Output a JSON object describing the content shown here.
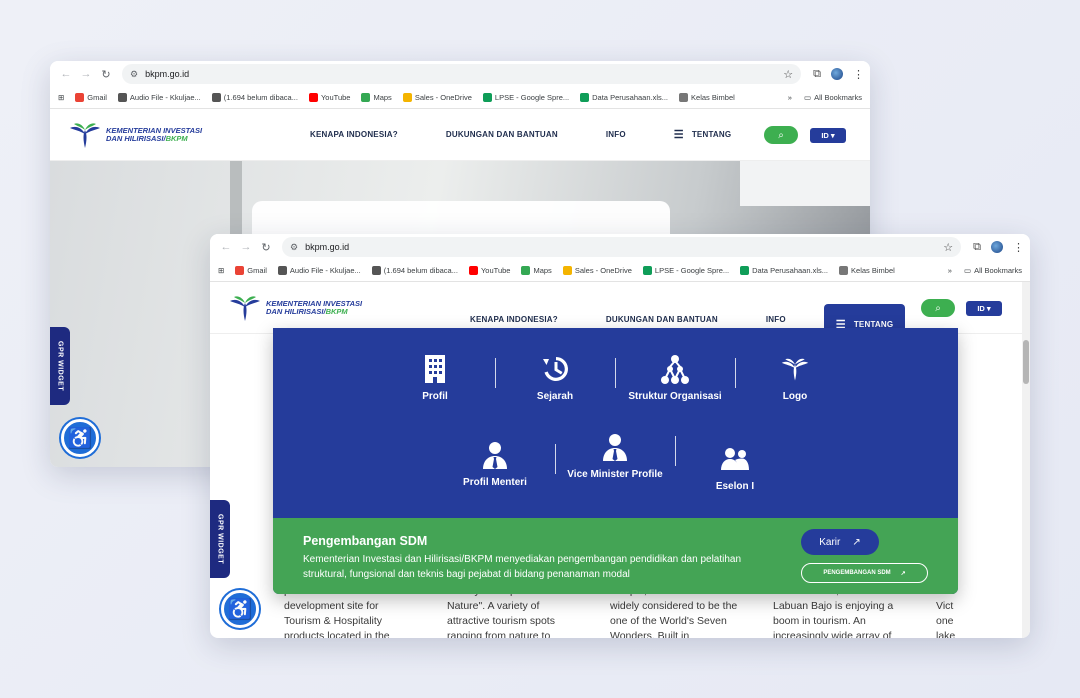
{
  "browser": {
    "url": "bkpm.go.id",
    "bookmarks": [
      {
        "label": "Gmail",
        "color": "#ea4335"
      },
      {
        "label": "Audio File - Kkuljae...",
        "color": "#555555"
      },
      {
        "label": "(1.694 belum dibaca...",
        "color": "#555555"
      },
      {
        "label": "YouTube",
        "color": "#ff0000"
      },
      {
        "label": "Maps",
        "color": "#34a853"
      },
      {
        "label": "Sales - OneDrive",
        "color": "#f4b400"
      },
      {
        "label": "LPSE - Google Spre...",
        "color": "#0f9d58"
      },
      {
        "label": "Data Perusahaan.xls...",
        "color": "#0f9d58"
      },
      {
        "label": "Kelas Bimbel",
        "color": "#777777"
      }
    ],
    "more": "»",
    "all_bookmarks": "All Bookmarks"
  },
  "site": {
    "logo_line1": "KEMENTERIAN INVESTASI",
    "logo_line2a": "DAN HILIRISASI/",
    "logo_line2b": "BKPM",
    "nav": [
      "KENAPA INDONESIA?",
      "DUKUNGAN DAN BANTUAN",
      "INFO",
      "TENTANG"
    ],
    "lang": "ID ▾",
    "gpr": "GPR WIDGET"
  },
  "mega_menu": {
    "items": [
      "Profil",
      "Sejarah",
      "Struktur Organisasi",
      "Logo",
      "Profil Menteri",
      "Vice Minister Profile",
      "Eselon I"
    ],
    "sdm_title": "Pengembangan SDM",
    "sdm_desc": "Kementerian Investasi dan Hilirisasi/BKPM menyediakan pengembangan pendidikan dan pelatihan struktural, fungsional dan teknis bagi pejabat di bidang penanaman modal",
    "karir_label": "Karir",
    "pengembangan_label": "PENGEMBANGAN SDM"
  },
  "content_columns": [
    "prime beach front development site for Tourism & Hospitality products located in the",
    "Beauty – Keep The Nature\". A variety of attractive tourism spots ranging from nature to",
    "Temple, an ancient site widely considered to be the one of the World's Seven Wonders. Built in",
    "National Park, the town of Labuan Bajo is enjoying a boom in tourism. An increasingly wide array of",
    "lake Vict one lake"
  ],
  "colors": {
    "brand_blue": "#253c9b",
    "brand_green": "#3daf50",
    "sdm_green": "#44a455"
  }
}
